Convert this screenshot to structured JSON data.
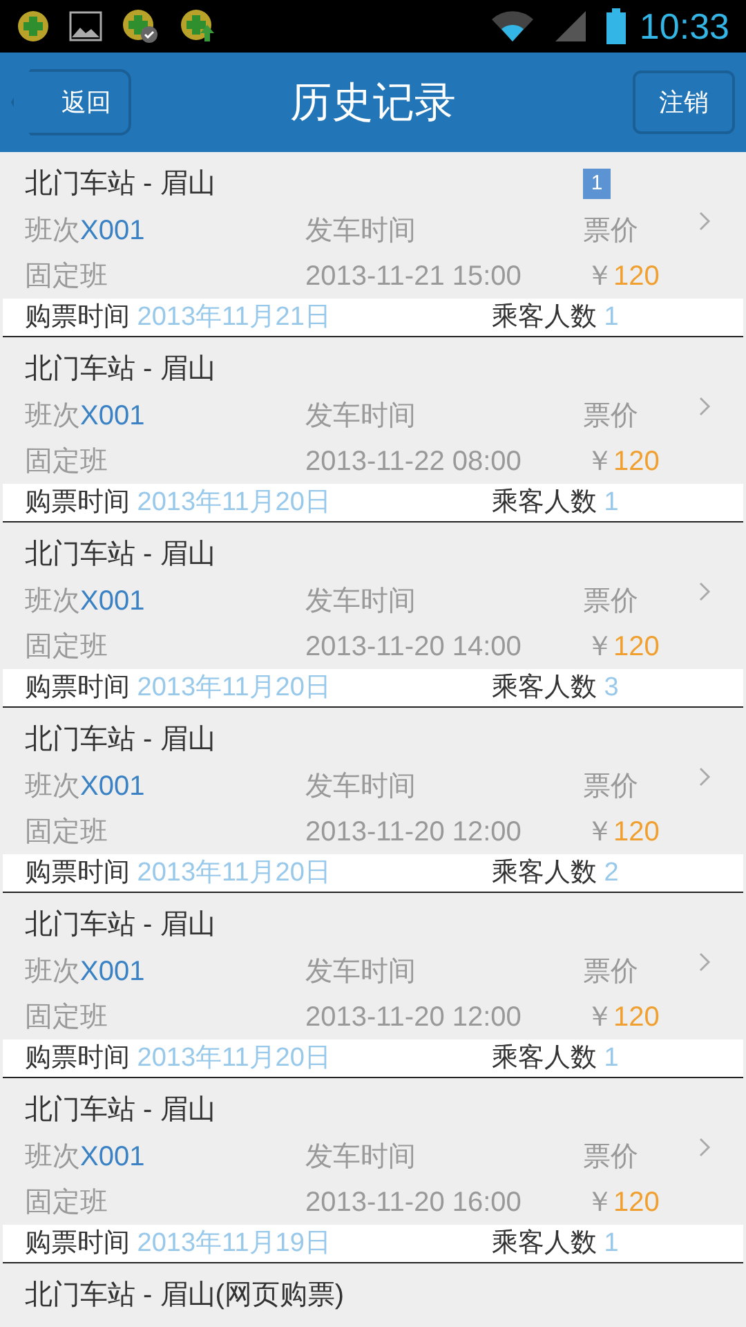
{
  "status_bar": {
    "time": "10:33"
  },
  "header": {
    "back": "返回",
    "title": "历史记录",
    "logout": "注销"
  },
  "records": [
    {
      "route": "北门车站 - 眉山",
      "badge": "1",
      "train_label": "班次",
      "train_no": "X001",
      "depart_label": "发车时间",
      "price_label": "票价",
      "type": "固定班",
      "depart_time": "2013-11-21 15:00",
      "currency": "￥",
      "price": "120",
      "purchase_label": "购票时间",
      "purchase_date": "2013年11月21日",
      "passengers_label": "乘客人数",
      "passengers": "1"
    },
    {
      "route": "北门车站 - 眉山",
      "train_label": "班次",
      "train_no": "X001",
      "depart_label": "发车时间",
      "price_label": "票价",
      "type": "固定班",
      "depart_time": "2013-11-22 08:00",
      "currency": "￥",
      "price": "120",
      "purchase_label": "购票时间",
      "purchase_date": "2013年11月20日",
      "passengers_label": "乘客人数",
      "passengers": "1"
    },
    {
      "route": "北门车站 - 眉山",
      "train_label": "班次",
      "train_no": "X001",
      "depart_label": "发车时间",
      "price_label": "票价",
      "type": "固定班",
      "depart_time": "2013-11-20 14:00",
      "currency": "￥",
      "price": "120",
      "purchase_label": "购票时间",
      "purchase_date": "2013年11月20日",
      "passengers_label": "乘客人数",
      "passengers": "3"
    },
    {
      "route": "北门车站 - 眉山",
      "train_label": "班次",
      "train_no": "X001",
      "depart_label": "发车时间",
      "price_label": "票价",
      "type": "固定班",
      "depart_time": "2013-11-20 12:00",
      "currency": "￥",
      "price": "120",
      "purchase_label": "购票时间",
      "purchase_date": "2013年11月20日",
      "passengers_label": "乘客人数",
      "passengers": "2"
    },
    {
      "route": "北门车站 - 眉山",
      "train_label": "班次",
      "train_no": "X001",
      "depart_label": "发车时间",
      "price_label": "票价",
      "type": "固定班",
      "depart_time": "2013-11-20 12:00",
      "currency": "￥",
      "price": "120",
      "purchase_label": "购票时间",
      "purchase_date": "2013年11月20日",
      "passengers_label": "乘客人数",
      "passengers": "1"
    },
    {
      "route": "北门车站 - 眉山",
      "train_label": "班次",
      "train_no": "X001",
      "depart_label": "发车时间",
      "price_label": "票价",
      "type": "固定班",
      "depart_time": "2013-11-20 16:00",
      "currency": "￥",
      "price": "120",
      "purchase_label": "购票时间",
      "purchase_date": "2013年11月19日",
      "passengers_label": "乘客人数",
      "passengers": "1"
    },
    {
      "route": "北门车站 - 眉山(网页购票)"
    }
  ]
}
